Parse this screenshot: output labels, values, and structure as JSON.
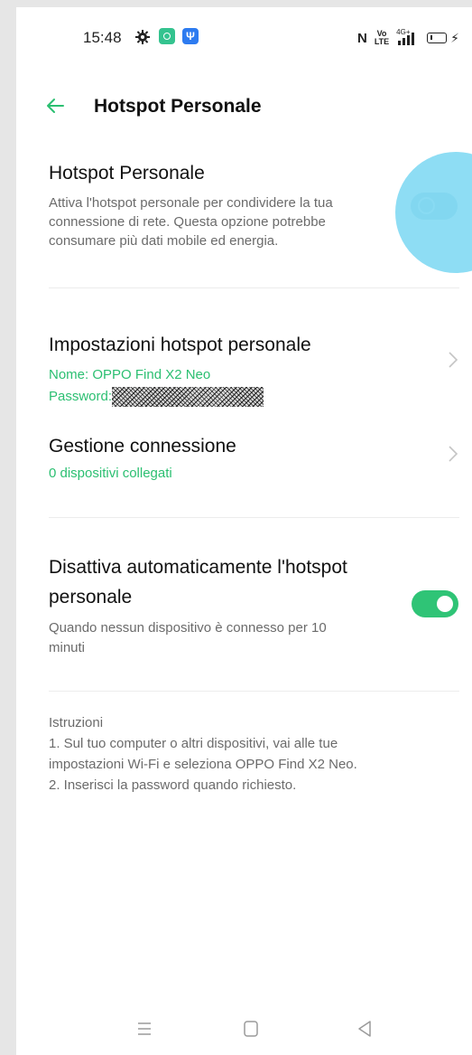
{
  "status_bar": {
    "time": "15:48",
    "icons": [
      "gear-icon",
      "app-notification-icon",
      "usb-icon",
      "nfc-icon",
      "volte-icon",
      "signal-4g-icon",
      "battery-icon",
      "charging-icon"
    ],
    "nfc": "N",
    "volte": "Vo\nLTE",
    "network": "4G+",
    "bolt": "⚡"
  },
  "header": {
    "back_icon": "arrow-left-icon",
    "title": "Hotspot Personale"
  },
  "hotspot": {
    "title": "Hotspot Personale",
    "description": "Attiva l'hotspot personale per condividere la tua connessione di rete. Questa opzione potrebbe consumare più dati mobile ed energia.",
    "enabled": false
  },
  "settings": {
    "title": "Impostazioni hotspot personale",
    "name_line": "Nome: OPPO Find X2 Neo",
    "password_label": "Password:"
  },
  "connection": {
    "title": "Gestione connessione",
    "devices": "0 dispositivi collegati"
  },
  "auto_off": {
    "title_line1": "Disattiva automaticamente l'hotspot",
    "title_line2": "personale",
    "description_line1": "Quando nessun dispositivo è connesso per 10",
    "description_line2": "minuti",
    "enabled": true
  },
  "instructions": {
    "heading": "Istruzioni",
    "line1": "1. Sul tuo computer o altri dispositivi, vai alle tue",
    "line2": "impostazioni Wi-Fi e seleziona OPPO Find X2 Neo.",
    "line3": "2. Inserisci la password quando richiesto."
  },
  "colors": {
    "accent": "#2bbf71",
    "toggle_on": "#2fc476",
    "touch_indicator": "#68d2f0"
  }
}
